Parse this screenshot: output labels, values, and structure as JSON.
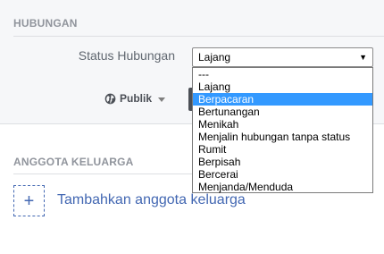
{
  "relationship_section": {
    "title": "HUBUNGAN",
    "status_label": "Status Hubungan",
    "status_value": "Lajang",
    "options": [
      "---",
      "Lajang",
      "Berpacaran",
      "Bertunangan",
      "Menikah",
      "Menjalin hubungan tanpa status",
      "Rumit",
      "Berpisah",
      "Bercerai",
      "Menjanda/Menduda"
    ],
    "highlighted_option": "Berpacaran",
    "privacy_label": "Publik",
    "privacy_icon": "globe-icon"
  },
  "family_section": {
    "title": "ANGGOTA KELUARGA",
    "add_label": "Tambahkan anggota keluarga",
    "add_icon": "plus-icon"
  },
  "colors": {
    "panel_bg": "#f6f7f9",
    "link": "#4267b2",
    "highlight": "#3399ff"
  }
}
